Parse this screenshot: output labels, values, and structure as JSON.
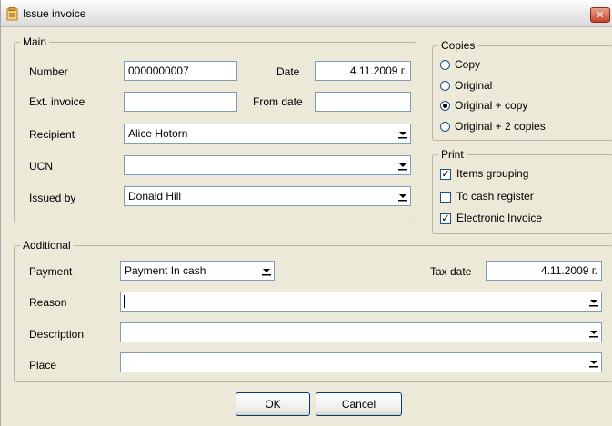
{
  "window": {
    "title": "Issue invoice",
    "close_symbol": "✕"
  },
  "main_group": {
    "legend": "Main",
    "number_label": "Number",
    "number_value": "0000000007",
    "date_label": "Date",
    "date_value": "4.11.2009 г.",
    "ext_invoice_label": "Ext. invoice",
    "ext_invoice_value": "",
    "from_date_label": "From date",
    "from_date_value": "",
    "recipient_label": "Recipient",
    "recipient_value": "Alice Hotorn",
    "ucn_label": "UCN",
    "ucn_value": "",
    "issued_by_label": "Issued by",
    "issued_by_value": "Donald Hill"
  },
  "copies_group": {
    "legend": "Copies",
    "options": [
      "Copy",
      "Original",
      "Original + copy",
      "Original + 2 copies"
    ],
    "selected": "Original + copy"
  },
  "print_group": {
    "legend": "Print",
    "items_grouping_label": "Items grouping",
    "items_grouping_checked": true,
    "to_cash_register_label": "To cash register",
    "to_cash_register_checked": false,
    "electronic_invoice_label": "Electronic Invoice",
    "electronic_invoice_checked": true
  },
  "additional_group": {
    "legend": "Additional",
    "payment_label": "Payment",
    "payment_value": "Payment In cash",
    "tax_date_label": "Tax date",
    "tax_date_value": "4.11.2009 г.",
    "reason_label": "Reason",
    "reason_value": "",
    "description_label": "Description",
    "description_value": "",
    "place_label": "Place",
    "place_value": ""
  },
  "buttons": {
    "ok_label": "OK",
    "cancel_label": "Cancel"
  },
  "icons": {
    "app": "invoice-icon",
    "dropdown": "chevron-down-icon",
    "close": "close-icon"
  }
}
